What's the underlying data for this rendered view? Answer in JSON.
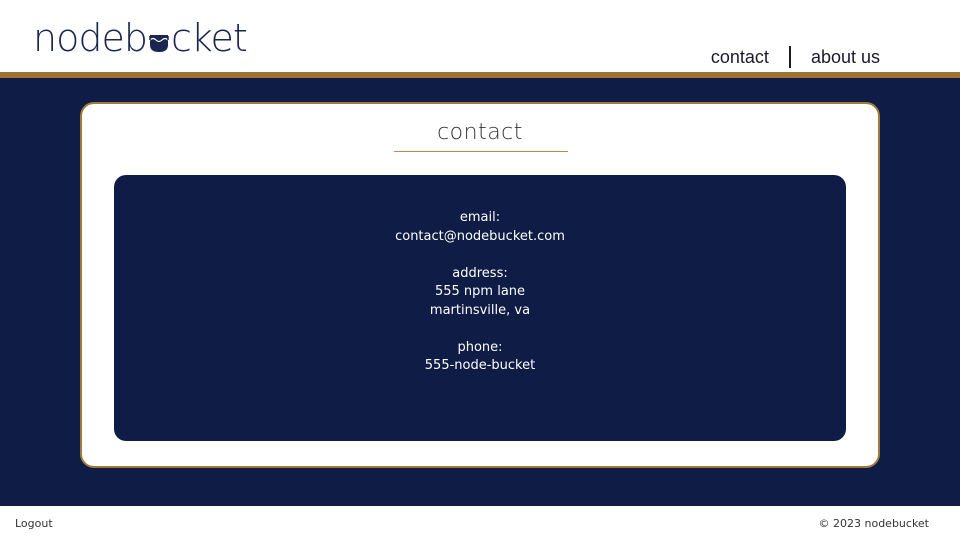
{
  "header": {
    "logo": {
      "text_before": "nodeb",
      "text_after": "cket",
      "icon": "bucket-u-icon"
    },
    "nav": [
      {
        "label": "contact"
      },
      {
        "label": "about us"
      }
    ]
  },
  "colors": {
    "navy": "#0f1c45",
    "gold": "#9c7433",
    "white": "#ffffff"
  },
  "card": {
    "title": "contact",
    "email_label": "email:",
    "email_value": "contact@nodebucket.com",
    "address_label": "address:",
    "address_line1": "555 npm lane",
    "address_line2": "martinsville, va",
    "phone_label": "phone:",
    "phone_value": "555-node-bucket"
  },
  "footer": {
    "logout": "Logout",
    "copyright": "© 2023 nodebucket"
  }
}
